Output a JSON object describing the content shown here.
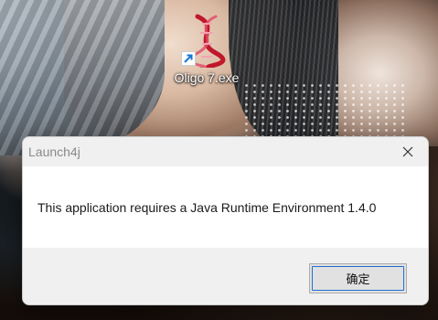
{
  "desktop": {
    "icon": {
      "label": "Oligo 7.exe",
      "icon_name": "dna-helix-icon",
      "overlay_icon_name": "shortcut-arrow-icon"
    }
  },
  "dialog": {
    "title": "Launch4j",
    "message": "This application requires a Java Runtime Environment 1.4.0",
    "ok_label": "确定",
    "close_icon": "close-icon",
    "accent_color": "#1f6fd1"
  }
}
